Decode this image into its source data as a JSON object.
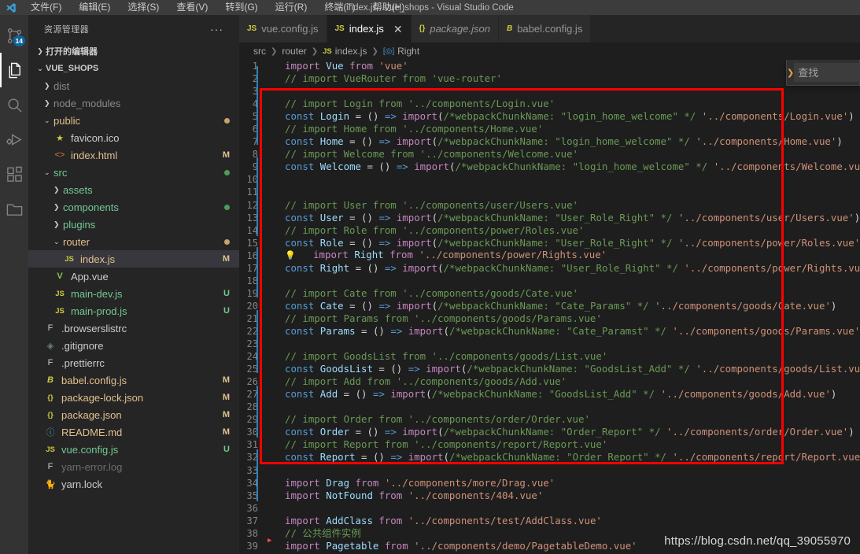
{
  "window": {
    "title": "index.js - vue_shops - Visual Studio Code",
    "logo_icon": "vscode-logo-icon"
  },
  "menubar": {
    "items": [
      {
        "label": "文件(F)",
        "name": "menu-file"
      },
      {
        "label": "编辑(E)",
        "name": "menu-edit"
      },
      {
        "label": "选择(S)",
        "name": "menu-selection"
      },
      {
        "label": "查看(V)",
        "name": "menu-view"
      },
      {
        "label": "转到(G)",
        "name": "menu-go"
      },
      {
        "label": "运行(R)",
        "name": "menu-run"
      },
      {
        "label": "终端(T)",
        "name": "menu-terminal"
      },
      {
        "label": "帮助(H)",
        "name": "menu-help"
      }
    ]
  },
  "activitybar": {
    "items": [
      {
        "icon": "source-control-icon",
        "badge": "14",
        "active": false
      },
      {
        "icon": "explorer-files-icon",
        "badge": "",
        "active": true
      },
      {
        "icon": "search-icon",
        "badge": "",
        "active": false
      },
      {
        "icon": "run-and-debug-icon",
        "badge": "",
        "active": false
      },
      {
        "icon": "extensions-icon",
        "badge": "",
        "active": false
      },
      {
        "icon": "remote-folder-icon",
        "badge": "",
        "active": false
      }
    ]
  },
  "sidebar": {
    "header_title": "资源管理器",
    "more_actions": "···",
    "open_editors_label": "打开的编辑器",
    "project_label": "VUE_SHOPS",
    "tree": [
      {
        "label": "dist",
        "indent": 1,
        "type": "folder",
        "expanded": false,
        "deco": "",
        "icon": "chevron-right-icon",
        "color": "#8a8a8a",
        "dot": ""
      },
      {
        "label": "node_modules",
        "indent": 1,
        "type": "folder",
        "expanded": false,
        "deco": "",
        "icon": "chevron-right-icon",
        "color": "#8a8a8a",
        "dot": ""
      },
      {
        "label": "public",
        "indent": 1,
        "type": "folder",
        "expanded": true,
        "deco": "",
        "icon": "chevron-down-icon",
        "color": "#e2c08d",
        "dot": "#c9a26a"
      },
      {
        "label": "favicon.ico",
        "indent": 2,
        "type": "file",
        "expanded": false,
        "deco": "",
        "icon": "star-icon",
        "color": "#cccccc",
        "dot": ""
      },
      {
        "label": "index.html",
        "indent": 2,
        "type": "file",
        "expanded": false,
        "deco": "M",
        "icon": "html-icon",
        "color": "#e2c08d",
        "dot": ""
      },
      {
        "label": "src",
        "indent": 1,
        "type": "folder",
        "expanded": true,
        "deco": "",
        "icon": "chevron-down-icon",
        "color": "#73c991",
        "dot": "#4a9e5c"
      },
      {
        "label": "assets",
        "indent": 2,
        "type": "folder",
        "expanded": false,
        "deco": "",
        "icon": "chevron-right-icon",
        "color": "#73c991",
        "dot": ""
      },
      {
        "label": "components",
        "indent": 2,
        "type": "folder",
        "expanded": false,
        "deco": "",
        "icon": "chevron-right-icon",
        "color": "#73c991",
        "dot": "#4a9e5c"
      },
      {
        "label": "plugins",
        "indent": 2,
        "type": "folder",
        "expanded": false,
        "deco": "",
        "icon": "chevron-right-icon",
        "color": "#73c991",
        "dot": ""
      },
      {
        "label": "router",
        "indent": 2,
        "type": "folder",
        "expanded": true,
        "deco": "",
        "icon": "chevron-down-icon",
        "color": "#e2c08d",
        "dot": "#c9a26a"
      },
      {
        "label": "index.js",
        "indent": 3,
        "type": "file",
        "expanded": false,
        "deco": "M",
        "icon": "js-icon",
        "color": "#e2c08d",
        "dot": "",
        "selected": true
      },
      {
        "label": "App.vue",
        "indent": 2,
        "type": "file",
        "expanded": false,
        "deco": "",
        "icon": "vue-icon",
        "color": "#cccccc",
        "dot": ""
      },
      {
        "label": "main-dev.js",
        "indent": 2,
        "type": "file",
        "expanded": false,
        "deco": "U",
        "icon": "js-icon",
        "color": "#73c991",
        "dot": ""
      },
      {
        "label": "main-prod.js",
        "indent": 2,
        "type": "file",
        "expanded": false,
        "deco": "U",
        "icon": "js-icon",
        "color": "#73c991",
        "dot": ""
      },
      {
        "label": ".browserslistrc",
        "indent": 1,
        "type": "file",
        "expanded": false,
        "deco": "",
        "icon": "config-icon",
        "color": "#cccccc",
        "dot": ""
      },
      {
        "label": ".gitignore",
        "indent": 1,
        "type": "file",
        "expanded": false,
        "deco": "",
        "icon": "git-icon",
        "color": "#cccccc",
        "dot": ""
      },
      {
        "label": ".prettierrc",
        "indent": 1,
        "type": "file",
        "expanded": false,
        "deco": "",
        "icon": "config-icon",
        "color": "#cccccc",
        "dot": ""
      },
      {
        "label": "babel.config.js",
        "indent": 1,
        "type": "file",
        "expanded": false,
        "deco": "M",
        "icon": "babel-icon",
        "color": "#e2c08d",
        "dot": ""
      },
      {
        "label": "package-lock.json",
        "indent": 1,
        "type": "file",
        "expanded": false,
        "deco": "M",
        "icon": "json-icon",
        "color": "#e2c08d",
        "dot": ""
      },
      {
        "label": "package.json",
        "indent": 1,
        "type": "file",
        "expanded": false,
        "deco": "M",
        "icon": "json-icon",
        "color": "#e2c08d",
        "dot": ""
      },
      {
        "label": "README.md",
        "indent": 1,
        "type": "file",
        "expanded": false,
        "deco": "M",
        "icon": "info-icon",
        "color": "#e2c08d",
        "dot": ""
      },
      {
        "label": "vue.config.js",
        "indent": 1,
        "type": "file",
        "expanded": false,
        "deco": "U",
        "icon": "js-icon",
        "color": "#73c991",
        "dot": ""
      },
      {
        "label": "yarn-error.log",
        "indent": 1,
        "type": "file",
        "expanded": false,
        "deco": "",
        "icon": "config-icon",
        "color": "#6e6e6e",
        "dot": ""
      },
      {
        "label": "yarn.lock",
        "indent": 1,
        "type": "file",
        "expanded": false,
        "deco": "",
        "icon": "yarn-icon",
        "color": "#cccccc",
        "dot": ""
      }
    ]
  },
  "tabs": [
    {
      "label": "vue.config.js",
      "icon": "js-icon",
      "active": false,
      "italic": false,
      "close": ""
    },
    {
      "label": "index.js",
      "icon": "js-icon",
      "active": true,
      "italic": false,
      "close": "✕"
    },
    {
      "label": "package.json",
      "icon": "json-icon",
      "active": false,
      "italic": true,
      "close": ""
    },
    {
      "label": "babel.config.js",
      "icon": "babel-icon",
      "active": false,
      "italic": false,
      "close": ""
    }
  ],
  "breadcrumb": {
    "parts": [
      "src",
      "router",
      "index.js",
      "Right"
    ],
    "file_icon": "js-icon",
    "symbol_icon": "symbol-variable-icon",
    "separator": "›"
  },
  "find_widget": {
    "toggle_icon": "chevron-right-icon",
    "placeholder": "查找",
    "value": ""
  },
  "watermark": "https://blog.csdn.net/qq_39055970",
  "editor": {
    "cursor_line": 17,
    "annotation_color": "#ff0000",
    "lines": [
      {
        "n": 1,
        "text": "import Vue from 'vue'"
      },
      {
        "n": 2,
        "text": "// import VueRouter from 'vue-router'"
      },
      {
        "n": 3,
        "text": ""
      },
      {
        "n": 4,
        "text": "// import Login from '../components/Login.vue'"
      },
      {
        "n": 5,
        "text": "const Login = () => import(/*webpackChunkName: \"login_home_welcome\" */ '../components/Login.vue')"
      },
      {
        "n": 6,
        "text": "// import Home from '../components/Home.vue'"
      },
      {
        "n": 7,
        "text": "const Home = () => import(/*webpackChunkName: \"login_home_welcome\" */ '../components/Home.vue')"
      },
      {
        "n": 8,
        "text": "// import Welcome from '../components/Welcome.vue'"
      },
      {
        "n": 9,
        "text": "const Welcome = () => import(/*webpackChunkName: \"login_home_welcome\" */ '../components/Welcome.vue')"
      },
      {
        "n": 10,
        "text": ""
      },
      {
        "n": 11,
        "text": ""
      },
      {
        "n": 12,
        "text": "// import User from '../components/user/Users.vue'"
      },
      {
        "n": 13,
        "text": "const User = () => import(/*webpackChunkName: \"User_Role_Right\" */ '../components/user/Users.vue')"
      },
      {
        "n": 14,
        "text": "// import Role from '../components/power/Roles.vue'"
      },
      {
        "n": 15,
        "text": "const Role = () => import(/*webpackChunkName: \"User_Role_Right\" */ '../components/power/Roles.vue')"
      },
      {
        "n": 16,
        "text": "// import Right from '../components/power/Rights.vue'"
      },
      {
        "n": 17,
        "text": "const Right = () => import(/*webpackChunkName: \"User_Role_Right\" */ '../components/power/Rights.vue')"
      },
      {
        "n": 18,
        "text": ""
      },
      {
        "n": 19,
        "text": "// import Cate from '../components/goods/Cate.vue'"
      },
      {
        "n": 20,
        "text": "const Cate = () => import(/*webpackChunkName: \"Cate_Params\" */ '../components/goods/Cate.vue')"
      },
      {
        "n": 21,
        "text": "// import Params from '../components/goods/Params.vue'"
      },
      {
        "n": 22,
        "text": "const Params = () => import(/*webpackChunkName: \"Cate_Paramst\" */ '../components/goods/Params.vue')"
      },
      {
        "n": 23,
        "text": ""
      },
      {
        "n": 24,
        "text": "// import GoodsList from '../components/goods/List.vue'"
      },
      {
        "n": 25,
        "text": "const GoodsList = () => import(/*webpackChunkName: \"GoodsList_Add\" */ '../components/goods/List.vue')"
      },
      {
        "n": 26,
        "text": "// import Add from '../components/goods/Add.vue'"
      },
      {
        "n": 27,
        "text": "const Add = () => import(/*webpackChunkName: \"GoodsList_Add\" */ '../components/goods/Add.vue')"
      },
      {
        "n": 28,
        "text": ""
      },
      {
        "n": 29,
        "text": "// import Order from '../components/order/Order.vue'"
      },
      {
        "n": 30,
        "text": "const Order = () => import(/*webpackChunkName: \"Order_Report\" */ '../components/order/Order.vue')"
      },
      {
        "n": 31,
        "text": "// import Report from '../components/report/Report.vue'"
      },
      {
        "n": 32,
        "text": "const Report = () => import(/*webpackChunkName: \"Order_Report\" */ '../components/report/Report.vue')"
      },
      {
        "n": 33,
        "text": ""
      },
      {
        "n": 34,
        "text": "import Drag from '../components/more/Drag.vue'"
      },
      {
        "n": 35,
        "text": "import NotFound from '../components/404.vue'"
      },
      {
        "n": 36,
        "text": ""
      },
      {
        "n": 37,
        "text": "import AddClass from '../components/test/AddClass.vue'"
      },
      {
        "n": 38,
        "text": "// 公共组件实例"
      },
      {
        "n": 39,
        "text": "import Pagetable from '../components/demo/PagetableDemo.vue'"
      }
    ]
  }
}
